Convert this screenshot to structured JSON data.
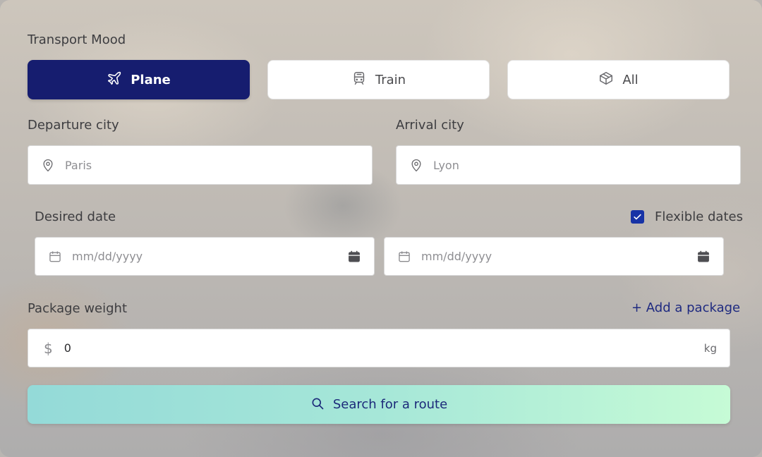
{
  "transport": {
    "section_label": "Transport Mood",
    "modes": [
      {
        "label": "Plane",
        "icon": "plane-icon",
        "selected": true
      },
      {
        "label": "Train",
        "icon": "train-icon",
        "selected": false
      },
      {
        "label": "All",
        "icon": "box-icon",
        "selected": false
      }
    ]
  },
  "departure": {
    "label": "Departure city",
    "placeholder": "Paris"
  },
  "arrival": {
    "label": "Arrival city",
    "placeholder": "Lyon"
  },
  "dates": {
    "label": "Desired date",
    "flexible_label": "Flexible dates",
    "flexible_checked": true,
    "start_placeholder": "mm/dd/yyyy",
    "end_placeholder": "mm/dd/yyyy"
  },
  "package": {
    "label": "Package weight",
    "add_label": "+ Add a package",
    "currency_symbol": "$",
    "value": "0",
    "unit": "kg"
  },
  "search": {
    "label": "Search for a route"
  },
  "colors": {
    "primary": "#161d6f",
    "checkbox": "#1733a6",
    "gradient_start": "#94dad8",
    "gradient_end": "#c6fbd6"
  }
}
